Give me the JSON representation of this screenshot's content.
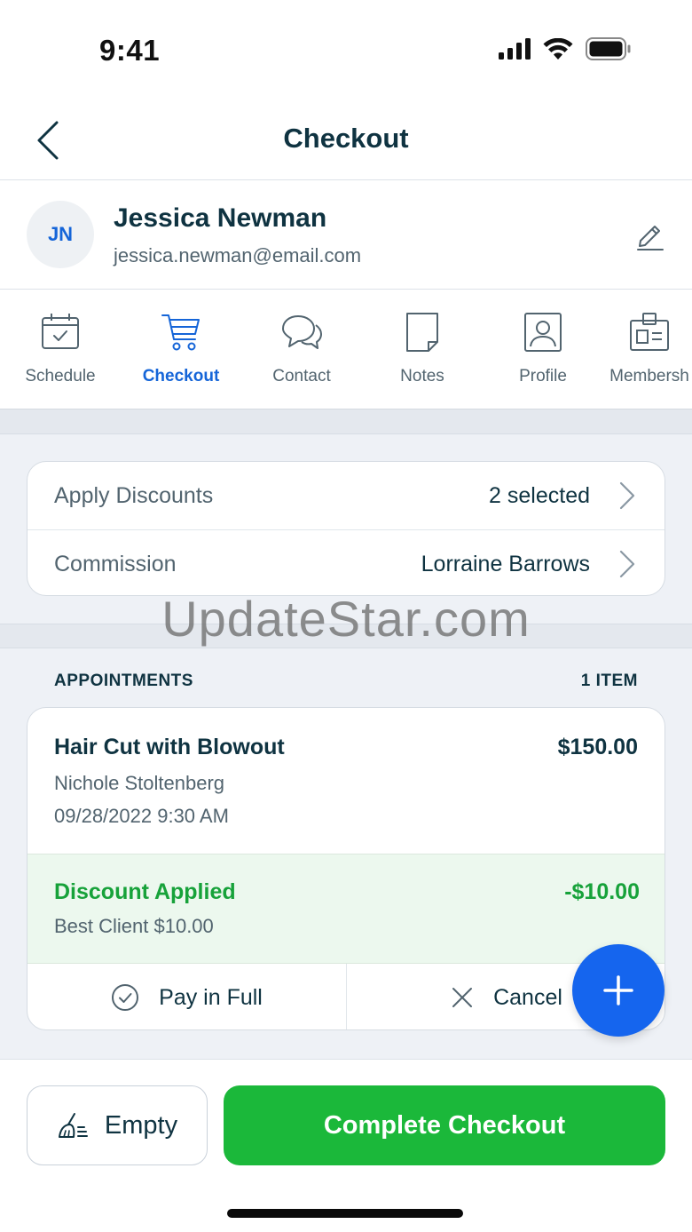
{
  "status_bar": {
    "time": "9:41"
  },
  "nav": {
    "title": "Checkout"
  },
  "client": {
    "initials": "JN",
    "name": "Jessica Newman",
    "email": "jessica.newman@email.com"
  },
  "tabs": [
    {
      "label": "Schedule",
      "icon": "calendar-check-icon",
      "active": false
    },
    {
      "label": "Checkout",
      "icon": "cart-icon",
      "active": true
    },
    {
      "label": "Contact",
      "icon": "chat-bubbles-icon",
      "active": false
    },
    {
      "label": "Notes",
      "icon": "note-icon",
      "active": false
    },
    {
      "label": "Profile",
      "icon": "profile-icon",
      "active": false
    },
    {
      "label": "Membersh",
      "icon": "id-badge-icon",
      "active": false
    }
  ],
  "settings": {
    "discounts": {
      "label": "Apply Discounts",
      "value": "2 selected"
    },
    "commission": {
      "label": "Commission",
      "value": "Lorraine Barrows"
    }
  },
  "watermark": "UpdateStar.com",
  "appointments": {
    "header": "APPOINTMENTS",
    "count": "1 ITEM",
    "item": {
      "service": "Hair Cut with Blowout",
      "price": "$150.00",
      "staff": "Nichole Stoltenberg",
      "datetime": "09/28/2022 9:30 AM",
      "discount": {
        "title": "Discount Applied",
        "amount": "-$10.00",
        "name": "Best Client $10.00"
      },
      "pay_label": "Pay in Full",
      "cancel_label": "Cancel"
    }
  },
  "footer": {
    "empty_label": "Empty",
    "complete_label": "Complete Checkout"
  },
  "colors": {
    "primary_blue": "#1565d8",
    "fab_blue": "#1565ee",
    "success_green": "#1bb83a",
    "discount_green": "#17a23a",
    "text_dark": "#0f3341",
    "text_muted": "#52646f"
  }
}
